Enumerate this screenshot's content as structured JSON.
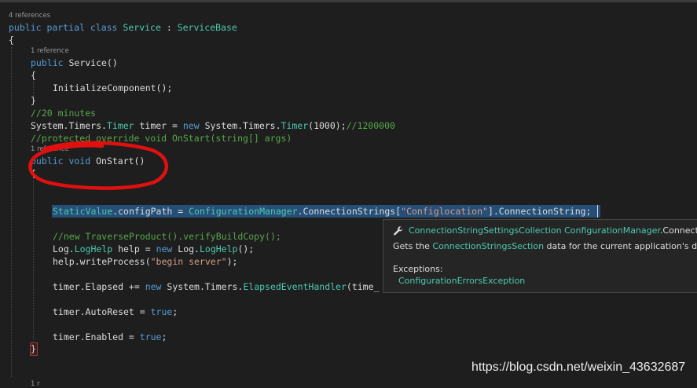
{
  "editor": {
    "lens_4_references": "4 references",
    "lens_1_reference_a": "1 reference",
    "lens_1_reference_b": "1 reference",
    "lens_bottom": "1 r",
    "code": {
      "class_kw": "public partial class",
      "class_name": "Service",
      "class_colon": " : ",
      "base_class": "ServiceBase",
      "open_brace": "{",
      "ctor_kw": "public",
      "ctor_name": " Service()",
      "ctor_open": "{",
      "init_call": "InitializeComponent();",
      "ctor_close": "}",
      "comment_minutes": "//20 minutes",
      "timer_ns1": "System.Timers.",
      "timer_type": "Timer",
      "timer_mid": " timer = ",
      "timer_new": "new",
      "timer_ns2": " System.Timers.",
      "timer_type2": "Timer",
      "timer_args": "(1000);",
      "timer_comment": "//1200000",
      "commented_onstart": "//protected override void OnStart(string[] args)",
      "onstart_kw": "public void",
      "onstart_name": " OnStart()",
      "onstart_open": "{",
      "static_type": "StaticValue",
      "static_member": ".configPath = ",
      "cfg_type": "ConfigurationManager",
      "cfg_member": ".ConnectionStrings[",
      "cfg_string": "\"Configlocation\"",
      "cfg_tail": "].ConnectionString;",
      "comment_traverse": "//new TraverseProduct().verifyBuildCopy();",
      "log_ns": "Log.",
      "log_type": "LogHelp",
      "log_mid": " help = ",
      "log_new": "new",
      "log_tail": " Log.",
      "log_type2": "LogHelp",
      "log_end": "();",
      "write_call": "help.writeProcess(",
      "write_string": "\"begin server\"",
      "write_end": ");",
      "elapsed_start": "timer.Elapsed += ",
      "elapsed_new": "new",
      "elapsed_ns": " System.Timers.",
      "elapsed_type": "ElapsedEventHandler",
      "elapsed_tail": "(time_",
      "autoreset": "timer.AutoReset = ",
      "autoreset_val": "true",
      "enabled": "timer.Enabled = ",
      "enabled_val": "true",
      "close_brace": "}"
    }
  },
  "tooltip": {
    "sig_type": "ConnectionStringSettingsCollection",
    "sig_owner": " ConfigurationManager",
    "sig_member": ".Connectio",
    "desc_pre": "Gets the ",
    "desc_link": "ConnectionStringsSection",
    "desc_post": " data for the current application's defau",
    "exceptions_label": "Exceptions:",
    "exception_item": "ConfigurationErrorsException"
  },
  "watermark": "https://blog.csdn.net/weixin_43632687",
  "colors": {
    "background": "#1e1e1e",
    "keyword": "#569cd6",
    "type": "#4ec9b0",
    "string": "#d69d85",
    "comment": "#57a64a",
    "selection": "#264f78",
    "annotation": "#e01010"
  },
  "icons": {
    "tooltip_icon": "wrench-icon"
  }
}
